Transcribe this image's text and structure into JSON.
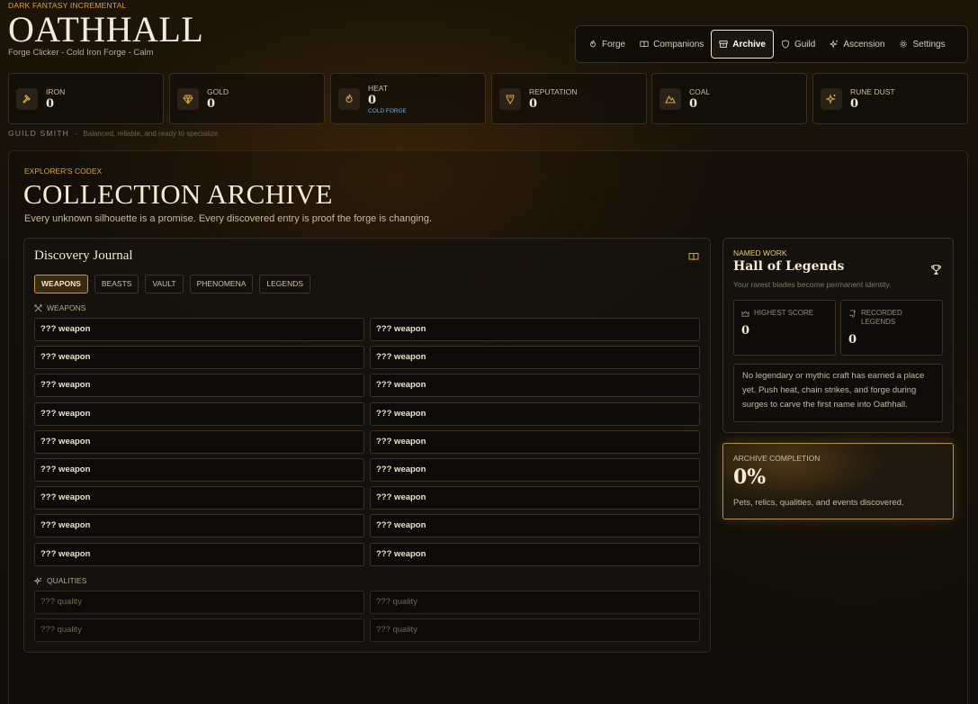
{
  "brand": {
    "tag": "Dark Fantasy Incremental",
    "title": "OATHHALL",
    "subtitle": "Forge Clicker - Cold Iron Forge - Calm"
  },
  "nav": [
    {
      "label": "Forge",
      "icon": "flame-icon",
      "active": false
    },
    {
      "label": "Companions",
      "icon": "book-icon",
      "active": false
    },
    {
      "label": "Archive",
      "icon": "archive-icon",
      "active": true
    },
    {
      "label": "Guild",
      "icon": "shield-icon",
      "active": false
    },
    {
      "label": "Ascension",
      "icon": "sparkles-icon",
      "active": false
    },
    {
      "label": "Settings",
      "icon": "gear-icon",
      "active": false
    }
  ],
  "resources": [
    {
      "label": "Iron",
      "value": "0",
      "icon": "hammer-icon",
      "note": ""
    },
    {
      "label": "Gold",
      "value": "0",
      "icon": "gem-icon",
      "note": ""
    },
    {
      "label": "Heat",
      "value": "0",
      "icon": "flame-icon",
      "note": "Cold Forge"
    },
    {
      "label": "Reputation",
      "value": "0",
      "icon": "badge-icon",
      "note": ""
    },
    {
      "label": "Coal",
      "value": "0",
      "icon": "mountain-icon",
      "note": ""
    },
    {
      "label": "Rune Dust",
      "value": "0",
      "icon": "sparkles-icon",
      "note": ""
    }
  ],
  "smith": {
    "title": "GUILD SMITH",
    "sep": "-",
    "desc": "Balanced, reliable, and ready to specialize."
  },
  "codex": {
    "tag": "Explorer's Codex",
    "title": "COLLECTION ARCHIVE",
    "subtitle": "Every unknown silhouette is a promise. Every discovered entry is proof the forge is changing."
  },
  "journal": {
    "title": "Discovery Journal",
    "tabs": [
      {
        "label": "Weapons",
        "active": true
      },
      {
        "label": "Beasts",
        "active": false
      },
      {
        "label": "Vault",
        "active": false
      },
      {
        "label": "Phenomena",
        "active": false
      },
      {
        "label": "Legends",
        "active": false
      }
    ],
    "weapons_heading": "Weapons",
    "weapons": [
      "??? weapon",
      "??? weapon",
      "??? weapon",
      "??? weapon",
      "??? weapon",
      "??? weapon",
      "??? weapon",
      "??? weapon",
      "??? weapon",
      "??? weapon",
      "??? weapon",
      "??? weapon",
      "??? weapon",
      "??? weapon",
      "??? weapon",
      "??? weapon",
      "??? weapon",
      "??? weapon"
    ],
    "qualities_heading": "Qualities",
    "qualities": [
      "??? quality",
      "??? quality",
      "??? quality",
      "??? quality"
    ]
  },
  "hall": {
    "tag": "Named Work",
    "title": "Hall of Legends",
    "subtitle": "Your rarest blades become permanent identity.",
    "highest_label": "Highest Score",
    "highest_value": "0",
    "recorded_label": "Recorded Legends",
    "recorded_value": "0",
    "note": "No legendary or mythic craft has earned a place yet. Push heat, chain strikes, and forge during surges to carve the first name into Oathhall."
  },
  "completion": {
    "tag": "Archive Completion",
    "value": "0%",
    "subtitle": "Pets, relics, qualities, and events discovered."
  },
  "colors": {
    "accent": "#d9a441",
    "info": "#6fb1e4"
  }
}
